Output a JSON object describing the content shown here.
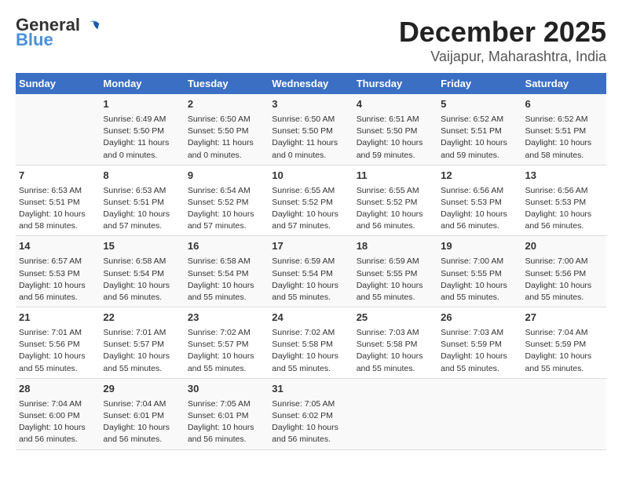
{
  "header": {
    "logo_line1": "General",
    "logo_line2": "Blue",
    "month": "December 2025",
    "location": "Vaijapur, Maharashtra, India"
  },
  "weekdays": [
    "Sunday",
    "Monday",
    "Tuesday",
    "Wednesday",
    "Thursday",
    "Friday",
    "Saturday"
  ],
  "weeks": [
    [
      {
        "day": "",
        "sunrise": "",
        "sunset": "",
        "daylight": ""
      },
      {
        "day": "1",
        "sunrise": "Sunrise: 6:49 AM",
        "sunset": "Sunset: 5:50 PM",
        "daylight": "Daylight: 11 hours and 0 minutes."
      },
      {
        "day": "2",
        "sunrise": "Sunrise: 6:50 AM",
        "sunset": "Sunset: 5:50 PM",
        "daylight": "Daylight: 11 hours and 0 minutes."
      },
      {
        "day": "3",
        "sunrise": "Sunrise: 6:50 AM",
        "sunset": "Sunset: 5:50 PM",
        "daylight": "Daylight: 11 hours and 0 minutes."
      },
      {
        "day": "4",
        "sunrise": "Sunrise: 6:51 AM",
        "sunset": "Sunset: 5:50 PM",
        "daylight": "Daylight: 10 hours and 59 minutes."
      },
      {
        "day": "5",
        "sunrise": "Sunrise: 6:52 AM",
        "sunset": "Sunset: 5:51 PM",
        "daylight": "Daylight: 10 hours and 59 minutes."
      },
      {
        "day": "6",
        "sunrise": "Sunrise: 6:52 AM",
        "sunset": "Sunset: 5:51 PM",
        "daylight": "Daylight: 10 hours and 58 minutes."
      }
    ],
    [
      {
        "day": "7",
        "sunrise": "Sunrise: 6:53 AM",
        "sunset": "Sunset: 5:51 PM",
        "daylight": "Daylight: 10 hours and 58 minutes."
      },
      {
        "day": "8",
        "sunrise": "Sunrise: 6:53 AM",
        "sunset": "Sunset: 5:51 PM",
        "daylight": "Daylight: 10 hours and 57 minutes."
      },
      {
        "day": "9",
        "sunrise": "Sunrise: 6:54 AM",
        "sunset": "Sunset: 5:52 PM",
        "daylight": "Daylight: 10 hours and 57 minutes."
      },
      {
        "day": "10",
        "sunrise": "Sunrise: 6:55 AM",
        "sunset": "Sunset: 5:52 PM",
        "daylight": "Daylight: 10 hours and 57 minutes."
      },
      {
        "day": "11",
        "sunrise": "Sunrise: 6:55 AM",
        "sunset": "Sunset: 5:52 PM",
        "daylight": "Daylight: 10 hours and 56 minutes."
      },
      {
        "day": "12",
        "sunrise": "Sunrise: 6:56 AM",
        "sunset": "Sunset: 5:53 PM",
        "daylight": "Daylight: 10 hours and 56 minutes."
      },
      {
        "day": "13",
        "sunrise": "Sunrise: 6:56 AM",
        "sunset": "Sunset: 5:53 PM",
        "daylight": "Daylight: 10 hours and 56 minutes."
      }
    ],
    [
      {
        "day": "14",
        "sunrise": "Sunrise: 6:57 AM",
        "sunset": "Sunset: 5:53 PM",
        "daylight": "Daylight: 10 hours and 56 minutes."
      },
      {
        "day": "15",
        "sunrise": "Sunrise: 6:58 AM",
        "sunset": "Sunset: 5:54 PM",
        "daylight": "Daylight: 10 hours and 56 minutes."
      },
      {
        "day": "16",
        "sunrise": "Sunrise: 6:58 AM",
        "sunset": "Sunset: 5:54 PM",
        "daylight": "Daylight: 10 hours and 55 minutes."
      },
      {
        "day": "17",
        "sunrise": "Sunrise: 6:59 AM",
        "sunset": "Sunset: 5:54 PM",
        "daylight": "Daylight: 10 hours and 55 minutes."
      },
      {
        "day": "18",
        "sunrise": "Sunrise: 6:59 AM",
        "sunset": "Sunset: 5:55 PM",
        "daylight": "Daylight: 10 hours and 55 minutes."
      },
      {
        "day": "19",
        "sunrise": "Sunrise: 7:00 AM",
        "sunset": "Sunset: 5:55 PM",
        "daylight": "Daylight: 10 hours and 55 minutes."
      },
      {
        "day": "20",
        "sunrise": "Sunrise: 7:00 AM",
        "sunset": "Sunset: 5:56 PM",
        "daylight": "Daylight: 10 hours and 55 minutes."
      }
    ],
    [
      {
        "day": "21",
        "sunrise": "Sunrise: 7:01 AM",
        "sunset": "Sunset: 5:56 PM",
        "daylight": "Daylight: 10 hours and 55 minutes."
      },
      {
        "day": "22",
        "sunrise": "Sunrise: 7:01 AM",
        "sunset": "Sunset: 5:57 PM",
        "daylight": "Daylight: 10 hours and 55 minutes."
      },
      {
        "day": "23",
        "sunrise": "Sunrise: 7:02 AM",
        "sunset": "Sunset: 5:57 PM",
        "daylight": "Daylight: 10 hours and 55 minutes."
      },
      {
        "day": "24",
        "sunrise": "Sunrise: 7:02 AM",
        "sunset": "Sunset: 5:58 PM",
        "daylight": "Daylight: 10 hours and 55 minutes."
      },
      {
        "day": "25",
        "sunrise": "Sunrise: 7:03 AM",
        "sunset": "Sunset: 5:58 PM",
        "daylight": "Daylight: 10 hours and 55 minutes."
      },
      {
        "day": "26",
        "sunrise": "Sunrise: 7:03 AM",
        "sunset": "Sunset: 5:59 PM",
        "daylight": "Daylight: 10 hours and 55 minutes."
      },
      {
        "day": "27",
        "sunrise": "Sunrise: 7:04 AM",
        "sunset": "Sunset: 5:59 PM",
        "daylight": "Daylight: 10 hours and 55 minutes."
      }
    ],
    [
      {
        "day": "28",
        "sunrise": "Sunrise: 7:04 AM",
        "sunset": "Sunset: 6:00 PM",
        "daylight": "Daylight: 10 hours and 56 minutes."
      },
      {
        "day": "29",
        "sunrise": "Sunrise: 7:04 AM",
        "sunset": "Sunset: 6:01 PM",
        "daylight": "Daylight: 10 hours and 56 minutes."
      },
      {
        "day": "30",
        "sunrise": "Sunrise: 7:05 AM",
        "sunset": "Sunset: 6:01 PM",
        "daylight": "Daylight: 10 hours and 56 minutes."
      },
      {
        "day": "31",
        "sunrise": "Sunrise: 7:05 AM",
        "sunset": "Sunset: 6:02 PM",
        "daylight": "Daylight: 10 hours and 56 minutes."
      },
      {
        "day": "",
        "sunrise": "",
        "sunset": "",
        "daylight": ""
      },
      {
        "day": "",
        "sunrise": "",
        "sunset": "",
        "daylight": ""
      },
      {
        "day": "",
        "sunrise": "",
        "sunset": "",
        "daylight": ""
      }
    ]
  ]
}
